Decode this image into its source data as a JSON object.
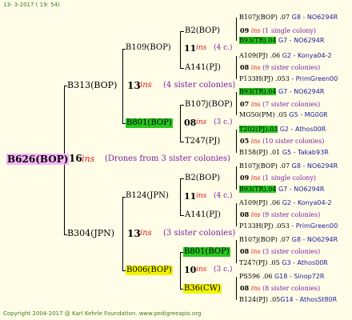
{
  "header": {
    "date": "13-  3-2017 ( 19: 54)"
  },
  "footer": {
    "copyright": "Copyright 2004-2017 @ Karl Kehrle Foundation.   www.pedigreeapis.org"
  },
  "tree": {
    "root": {
      "name": "B626(BOP)",
      "count": "16",
      "ins": "ins",
      "note": "(Drones from 3 sister colonies)"
    },
    "b313": {
      "name": "B313(BOP)",
      "count": "13",
      "ins": "ins",
      "note": "(4 sister colonies)"
    },
    "b304": {
      "name": "B304(JPN)",
      "count": "13",
      "ins": "ins",
      "note": "(3 sister colonies)"
    },
    "b109": {
      "name": "B109(BOP)",
      "count": "11",
      "ins": "ins",
      "note": "(4 c.)"
    },
    "b801a": {
      "name": "B801(BOP)",
      "count": "08",
      "ins": "ins",
      "note": "(3 c.)"
    },
    "b124": {
      "name": "B124(JPN)",
      "count": "11",
      "ins": "ins",
      "note": "(4 c.)"
    },
    "b006": {
      "name": "B006(BOP)",
      "count": "10",
      "ins": "ins",
      "note": "(3 c.)"
    },
    "b2a": {
      "name": "B2(BOP)",
      "count": "09",
      "ins": "ins",
      "note": "(1 single colony)"
    },
    "a141a": {
      "name": "A141(PJ)",
      "count": "08",
      "ins": "ins",
      "note": "(9 sister colonies)"
    },
    "b107a": {
      "name": "B107j(BOP)",
      "count": "07",
      "ins": "ins",
      "note": "(7 sister colonies)"
    },
    "t247a": {
      "name": "T247(PJ)",
      "count": "05",
      "ins": "ins",
      "note": "(10 sister colonies)"
    },
    "b2b": {
      "name": "B2(BOP)",
      "count": "09",
      "ins": "ins",
      "note": "(1 single colony)"
    },
    "a141b": {
      "name": "A141(PJ)",
      "count": "08",
      "ins": "ins",
      "note": "(9 sister colonies)"
    },
    "b801b": {
      "name": "B801(BOP)",
      "count": "08",
      "ins": "ins",
      "note": "(3 sister colonies)"
    },
    "b36": {
      "name": "B36(CW)",
      "count": "08",
      "ins": "ins",
      "note": "(8 sister colonies)"
    },
    "leaves": [
      {
        "name": "B107j(BOP)",
        "year": ".07",
        "tail": "G8 - NO6294R"
      },
      {
        "name": "B93(TR)",
        "year": ".04",
        "tail": "G7 - NO6294R"
      },
      {
        "name": "A109(PJ)",
        "year": ".06",
        "tail": "G2 - Konya04-2"
      },
      {
        "name": "P133H(PJ)",
        "year": ".053",
        "tail": "- PrimGreen00"
      },
      {
        "name": "B93(TR)",
        "year": ".04",
        "tail": "G7 - NO6294R"
      },
      {
        "name": "MG50(PM)",
        "year": ".05",
        "tail": "G5 - MG00R"
      },
      {
        "name": "T202(PJ)",
        "year": ".03",
        "tail": "G2 - Athos00R"
      },
      {
        "name": "B158(PJ)",
        "year": ".01",
        "tail": "G5 - Takab93R"
      },
      {
        "name": "B107j(BOP)",
        "year": ".07",
        "tail": "G8 - NO6294R"
      },
      {
        "name": "B93(TR)",
        "year": ".04",
        "tail": "G7 - NO6294R"
      },
      {
        "name": "A109(PJ)",
        "year": ".06",
        "tail": "G2 - Konya04-2"
      },
      {
        "name": "P133H(PJ)",
        "year": ".053",
        "tail": "- PrimGreen00"
      },
      {
        "name": "B107j(BOP)",
        "year": ".07",
        "tail": "G8 - NO6294R"
      },
      {
        "name": "T247(PJ)",
        "year": ".05",
        "tail": "G3 - Athos00R"
      },
      {
        "name": "PS596",
        "year": ".06",
        "tail": "G18 - Sinop72R"
      },
      {
        "name": "B124(PJ)",
        "year": ".05",
        "tail": "G14 - AthosSt80R"
      }
    ]
  }
}
